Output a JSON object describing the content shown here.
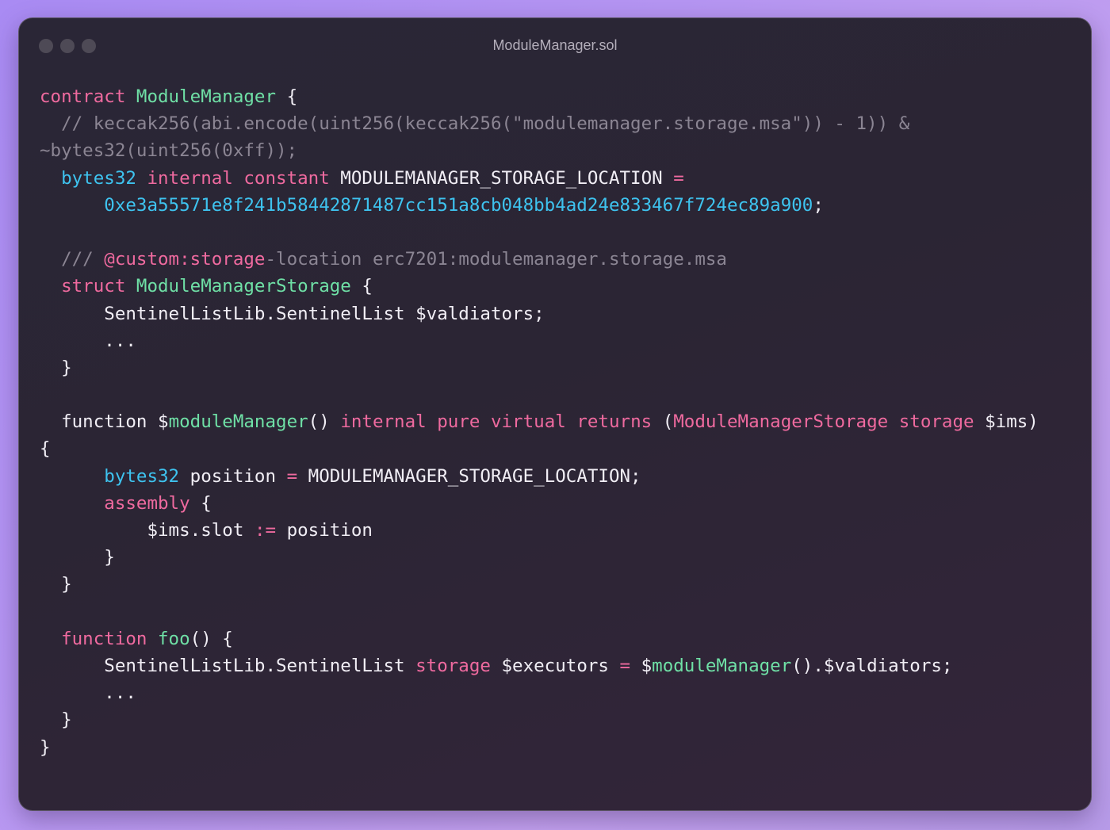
{
  "window": {
    "title": "ModuleManager.sol"
  },
  "colors": {
    "keyword": "#ef6a9f",
    "type": "#3ec3ef",
    "name": "#6fe0a6",
    "comment": "#8b8593",
    "text": "#f1eef5",
    "window_bg": "#2a2636",
    "page_bg": "#b595f2"
  },
  "code": {
    "lines": [
      [
        {
          "c": "kw",
          "t": "contract"
        },
        {
          "c": "tx",
          "t": " "
        },
        {
          "c": "nm",
          "t": "ModuleManager"
        },
        {
          "c": "tx",
          "t": " {"
        }
      ],
      [
        {
          "c": "cm",
          "t": "  // keccak256(abi.encode(uint256(keccak256(\"modulemanager.storage.msa\")) - 1)) &"
        }
      ],
      [
        {
          "c": "cm",
          "t": "~bytes32(uint256(0xff));"
        }
      ],
      [
        {
          "c": "tx",
          "t": "  "
        },
        {
          "c": "ty",
          "t": "bytes32"
        },
        {
          "c": "tx",
          "t": " "
        },
        {
          "c": "kw",
          "t": "internal"
        },
        {
          "c": "tx",
          "t": " "
        },
        {
          "c": "kw",
          "t": "constant"
        },
        {
          "c": "tx",
          "t": " MODULEMANAGER_STORAGE_LOCATION "
        },
        {
          "c": "kw",
          "t": "="
        }
      ],
      [
        {
          "c": "tx",
          "t": "      "
        },
        {
          "c": "ty",
          "t": "0xe3a55571e8f241b58442871487cc151a8cb048bb4ad24e833467f724ec89a900"
        },
        {
          "c": "tx",
          "t": ";"
        }
      ],
      [],
      [
        {
          "c": "cm",
          "t": "  /// "
        },
        {
          "c": "kw",
          "t": "@custom:storage"
        },
        {
          "c": "cm",
          "t": "-location erc7201:modulemanager.storage.msa"
        }
      ],
      [
        {
          "c": "tx",
          "t": "  "
        },
        {
          "c": "kw",
          "t": "struct"
        },
        {
          "c": "tx",
          "t": " "
        },
        {
          "c": "nm",
          "t": "ModuleManagerStorage"
        },
        {
          "c": "tx",
          "t": " {"
        }
      ],
      [
        {
          "c": "tx",
          "t": "      SentinelListLib.SentinelList $valdiators;"
        }
      ],
      [
        {
          "c": "tx",
          "t": "      ..."
        }
      ],
      [
        {
          "c": "tx",
          "t": "  }"
        }
      ],
      [],
      [
        {
          "c": "tx",
          "t": "  function $"
        },
        {
          "c": "nm",
          "t": "moduleManager"
        },
        {
          "c": "tx",
          "t": "() "
        },
        {
          "c": "kw",
          "t": "internal"
        },
        {
          "c": "tx",
          "t": " "
        },
        {
          "c": "kw",
          "t": "pure"
        },
        {
          "c": "tx",
          "t": " "
        },
        {
          "c": "kw",
          "t": "virtual"
        },
        {
          "c": "tx",
          "t": " "
        },
        {
          "c": "kw",
          "t": "returns"
        },
        {
          "c": "tx",
          "t": " ("
        },
        {
          "c": "kw",
          "t": "ModuleManagerStorage"
        },
        {
          "c": "tx",
          "t": " "
        },
        {
          "c": "kw",
          "t": "storage"
        },
        {
          "c": "tx",
          "t": " $ims)"
        }
      ],
      [
        {
          "c": "tx",
          "t": "{"
        }
      ],
      [
        {
          "c": "tx",
          "t": "      "
        },
        {
          "c": "ty",
          "t": "bytes32"
        },
        {
          "c": "tx",
          "t": " position "
        },
        {
          "c": "kw",
          "t": "="
        },
        {
          "c": "tx",
          "t": " MODULEMANAGER_STORAGE_LOCATION;"
        }
      ],
      [
        {
          "c": "tx",
          "t": "      "
        },
        {
          "c": "kw",
          "t": "assembly"
        },
        {
          "c": "tx",
          "t": " {"
        }
      ],
      [
        {
          "c": "tx",
          "t": "          $ims.slot "
        },
        {
          "c": "kw",
          "t": ":="
        },
        {
          "c": "tx",
          "t": " position"
        }
      ],
      [
        {
          "c": "tx",
          "t": "      }"
        }
      ],
      [
        {
          "c": "tx",
          "t": "  }"
        }
      ],
      [],
      [
        {
          "c": "tx",
          "t": "  "
        },
        {
          "c": "kw",
          "t": "function"
        },
        {
          "c": "tx",
          "t": " "
        },
        {
          "c": "nm",
          "t": "foo"
        },
        {
          "c": "tx",
          "t": "() {"
        }
      ],
      [
        {
          "c": "tx",
          "t": "      SentinelListLib.SentinelList "
        },
        {
          "c": "kw",
          "t": "storage"
        },
        {
          "c": "tx",
          "t": " $executors "
        },
        {
          "c": "kw",
          "t": "="
        },
        {
          "c": "tx",
          "t": " $"
        },
        {
          "c": "nm",
          "t": "moduleManager"
        },
        {
          "c": "tx",
          "t": "().$valdiators;"
        }
      ],
      [
        {
          "c": "tx",
          "t": "      ..."
        }
      ],
      [
        {
          "c": "tx",
          "t": "  }"
        }
      ],
      [
        {
          "c": "tx",
          "t": "}"
        }
      ]
    ]
  }
}
